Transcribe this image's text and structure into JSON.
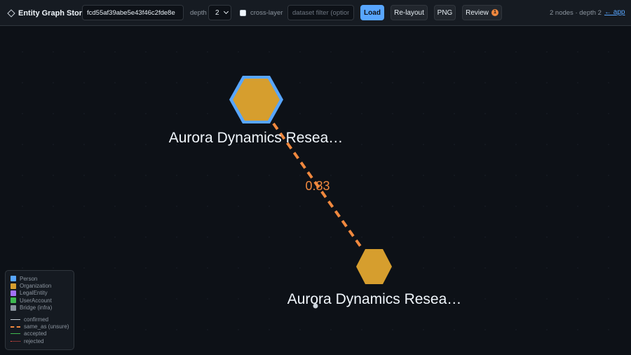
{
  "toolbar": {
    "title": "Entity Graph Store",
    "entity_id_value": "fcd55af39abe5e43f46c2fde8e",
    "depth_label": "depth",
    "depth_value": "2",
    "cross_layer_label": "cross-layer",
    "dataset_filter_placeholder": "dataset filter (optional)",
    "load_label": "Load",
    "relayout_label": "Re-layout",
    "png_label": "PNG",
    "review_label": "Review",
    "review_count": "1",
    "status_text": "2 nodes · depth 2",
    "back_link": "← app"
  },
  "graph": {
    "nodes": [
      {
        "label": "Aurora Dynamics Resea…",
        "type": "Organization",
        "selected": true
      },
      {
        "label": "Aurora Dynamics Resea…",
        "type": "Organization",
        "selected": false
      }
    ],
    "edges": [
      {
        "label": "0.83",
        "kind": "same_as (unsure)"
      }
    ],
    "colors": {
      "organization": "#d69e2e",
      "selection_ring": "#58a6ff",
      "edge_unsure": "#f0883e"
    }
  },
  "legend": {
    "node_types": [
      {
        "label": "Person",
        "color": "#58a6ff"
      },
      {
        "label": "Organization",
        "color": "#d69e2e"
      },
      {
        "label": "LegalEntity",
        "color": "#a371f7"
      },
      {
        "label": "UserAccount",
        "color": "#3fb950"
      },
      {
        "label": "Bridge (infra)",
        "color": "#8b949e"
      }
    ],
    "edge_types": [
      {
        "label": "confirmed",
        "color": "#c9d1d9",
        "style": "solid"
      },
      {
        "label": "same_as (unsure)",
        "color": "#f0883e",
        "style": "dashed"
      },
      {
        "label": "accepted",
        "color": "#3fb950",
        "style": "solid"
      },
      {
        "label": "rejected",
        "color": "#f85149",
        "style": "dotted"
      }
    ]
  }
}
